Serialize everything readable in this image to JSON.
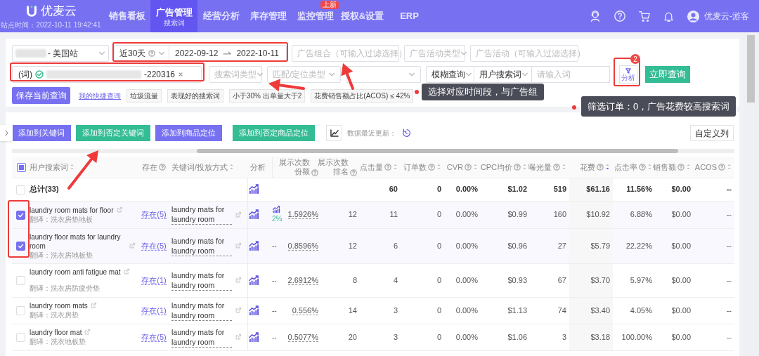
{
  "header": {
    "logo": "优麦云",
    "site_time": "站点时间：2022-10-11 19:42:41",
    "nav": [
      {
        "label": "销售看板",
        "selected": false
      },
      {
        "label": "广告管理",
        "sub": "搜索词",
        "selected": true
      },
      {
        "label": "经营分析",
        "selected": false
      },
      {
        "label": "库存管理",
        "selected": false
      },
      {
        "label": "监控管理",
        "badge": "上新",
        "selected": false
      },
      {
        "label": "授权&设置",
        "selected": false
      },
      {
        "label": "ERP",
        "selected": false
      }
    ],
    "user": "优麦云-游客"
  },
  "filters": {
    "store": "- 美国站",
    "range": "近30天",
    "start_date": "2022-09-12",
    "end_date": "2022-10-11",
    "portfolio_placeholder": "广告组合（可输入过滤选择）",
    "campaign_type": "广告活动类型",
    "campaign_placeholder": "广告活动（可输入过滤选择）",
    "ad_group_tag": "(词)",
    "ad_group": "-220316",
    "search_type": "搜索词类型",
    "match_type": "匹配/定位类型",
    "mode": "模糊查询",
    "field": "用户搜索词",
    "query_placeholder": "请输入词",
    "analysis_button": "分析",
    "analysis_badge": "2",
    "query_button": "立即查询",
    "save_button": "保存当前查询",
    "quick_link": "我的快捷查询",
    "chips": [
      "垃圾流量",
      "表现好的搜索词",
      "小于30% 出单量大于2",
      "花费销售额占比(ACOS) ≤ 42%"
    ]
  },
  "toolbar": {
    "buttons": [
      {
        "label": "添加到关键词",
        "kind": "primary"
      },
      {
        "label": "添加到否定关键词",
        "kind": "success"
      },
      {
        "label": "添加到商品定位",
        "kind": "primary"
      },
      {
        "label": "添加到否定商品定位",
        "kind": "success"
      }
    ],
    "updated_label": "数据最近更新：",
    "columns_button": "自定义列"
  },
  "tooltips": [
    "选择对应时间段，与广告组",
    "筛选订单：0，广告花费较高搜索词"
  ],
  "table": {
    "header_indeterminate": true,
    "columns": [
      {
        "label": "用户搜索词",
        "sort": true
      },
      {
        "label": "存在",
        "help": true
      },
      {
        "label": "关键词/投放方式",
        "sort": true
      },
      {
        "label": "分析"
      },
      {
        "label": "展示次数份额",
        "help": true
      },
      {
        "label": "展示次数排名",
        "help": true
      },
      {
        "label": "点击量",
        "help": true,
        "sort": true
      },
      {
        "label": "订单数",
        "help": true,
        "sort": true
      },
      {
        "label": "CVR",
        "help": true,
        "sort": true
      },
      {
        "label": "CPC均价",
        "help": true,
        "sort": true
      },
      {
        "label": "曝光量",
        "help": true,
        "sort": true
      },
      {
        "label": "花费",
        "help": true,
        "sort": true,
        "sorted": true
      },
      {
        "label": "点击率",
        "help": true,
        "sort": true
      },
      {
        "label": "销售额",
        "help": true,
        "sort": true
      },
      {
        "label": "ACOS",
        "help": true,
        "sort": true
      }
    ],
    "total": {
      "label": "总计(33)",
      "checked": false,
      "clicks": "60",
      "orders": "0",
      "cvr": "0.00%",
      "cpc": "$1.02",
      "impressions": "519",
      "spend": "$61.16",
      "ctr": "11.56%",
      "sales": "$0.00",
      "acos": "--"
    },
    "rows": [
      {
        "checked": true,
        "term": "laundry room mats for floor",
        "translation": "翻译：洗衣房垫地板",
        "exists": "存在(5)",
        "keyword": "laundry mats for laundry room",
        "column_1": {
          "text": "2%",
          "kind": "trend"
        },
        "share": "1.5926%",
        "rank": "12",
        "clicks": "11",
        "orders": "0",
        "cvr": "0.00%",
        "cpc": "$0.99",
        "impressions": "160",
        "spend": "$10.92",
        "ctr": "6.88%",
        "sales": "$0.00",
        "acos": "--"
      },
      {
        "checked": true,
        "term": "laundry floor mats for laundry room",
        "translation": "翻译：洗衣房地板垫",
        "exists": "存在(5)",
        "keyword": "laundry mats for laundry room",
        "column_1": {
          "text": "--",
          "kind": "plain"
        },
        "share": "0.8596%",
        "rank": "12",
        "clicks": "6",
        "orders": "0",
        "cvr": "0.00%",
        "cpc": "$0.96",
        "impressions": "27",
        "spend": "$5.79",
        "ctr": "22.22%",
        "sales": "$0.00",
        "acos": "--"
      },
      {
        "checked": false,
        "term": "laundry room anti fatigue mat",
        "translation": "翻译：洗衣房防疲劳垫",
        "exists": "存在(1)",
        "keyword": "laundry mats for laundry room",
        "column_1": {
          "text": "--",
          "kind": "plain"
        },
        "share": "2.6912%",
        "rank": "8",
        "clicks": "4",
        "orders": "0",
        "cvr": "0.00%",
        "cpc": "$0.93",
        "impressions": "67",
        "spend": "$3.70",
        "ctr": "5.97%",
        "sales": "$0.00",
        "acos": "--"
      },
      {
        "checked": false,
        "term": "laundry room mats",
        "translation": "翻译：洗衣房垫",
        "exists": "存在(1)",
        "keyword": "laundry mats for laundry room",
        "column_1": {
          "text": "--",
          "kind": "plain"
        },
        "share": "0.556%",
        "rank": "14",
        "clicks": "3",
        "orders": "0",
        "cvr": "0.00%",
        "cpc": "$1.13",
        "impressions": "74",
        "spend": "$3.40",
        "ctr": "4.05%",
        "sales": "$0.00",
        "acos": "--"
      },
      {
        "checked": false,
        "term": "laundry floor mat",
        "translation": "翻译：洗衣地板垫",
        "exists": "存在(5)",
        "keyword": "laundry mats for laundry room",
        "column_1": {
          "text": "--",
          "kind": "plain"
        },
        "share": "0.5077%",
        "rank": "20",
        "clicks": "3",
        "orders": "0",
        "cvr": "0.00%",
        "cpc": "$1.06",
        "impressions": "3",
        "spend": "$3.18",
        "ctr": "100.00%",
        "sales": "$0.00",
        "acos": "--"
      }
    ]
  }
}
